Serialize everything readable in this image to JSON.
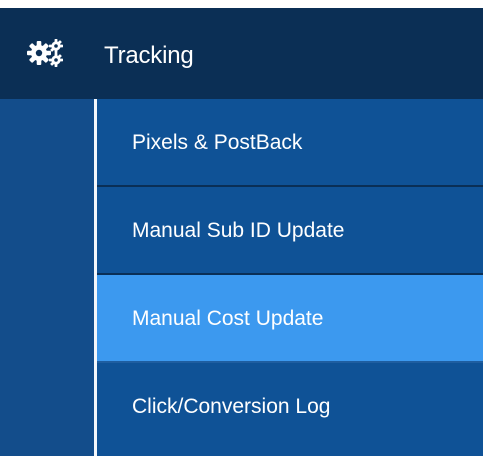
{
  "menu": {
    "header": {
      "icon": "gears-icon",
      "label": "Tracking"
    },
    "items": [
      {
        "label": "Pixels & PostBack",
        "active": false
      },
      {
        "label": "Manual Sub ID Update",
        "active": false
      },
      {
        "label": "Manual Cost Update",
        "active": true
      },
      {
        "label": "Click/Conversion Log",
        "active": false
      }
    ]
  },
  "colors": {
    "header_bg": "#0b2f55",
    "item_bg": "#0f5296",
    "active_bg": "#3c99ef",
    "rail_bg": "#134d8b",
    "text": "#ffffff"
  }
}
